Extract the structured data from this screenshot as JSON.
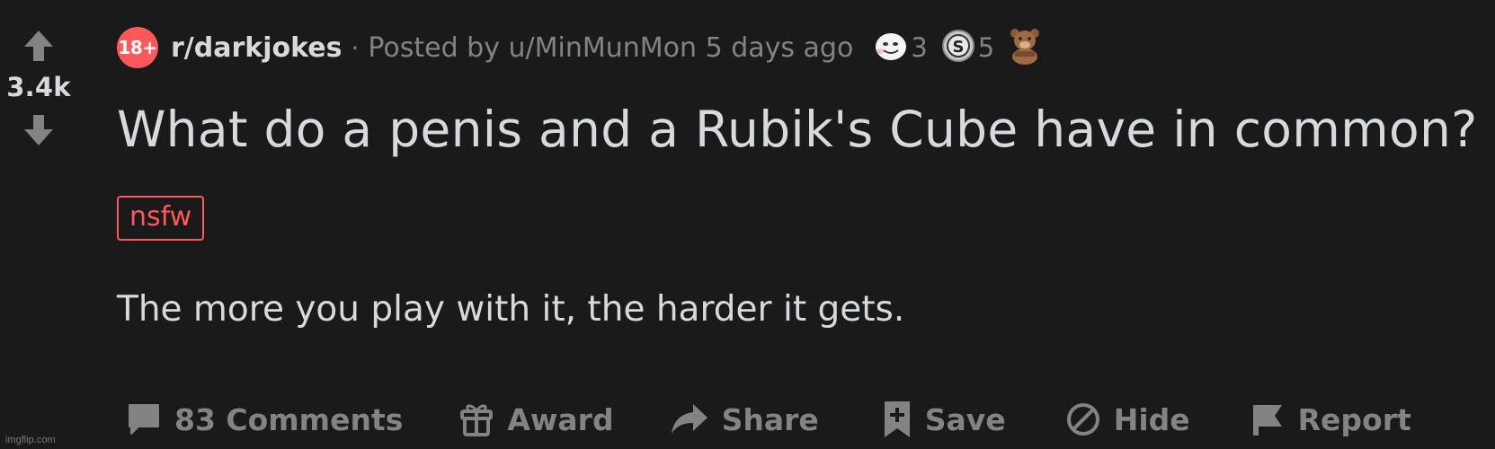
{
  "post": {
    "score": "3.4k",
    "subreddit_icon_label": "18+",
    "subreddit": "r/darkjokes",
    "separator": "·",
    "posted_by": "Posted by u/MinMunMon 5 days ago",
    "awards": [
      {
        "icon": "wholesome-award-icon",
        "count": "3"
      },
      {
        "icon": "silver-award-icon",
        "count": "5"
      },
      {
        "icon": "bear-award-icon",
        "count": ""
      }
    ],
    "title": "What do a penis and a Rubik's Cube have in common?",
    "flair": "nsfw",
    "body": "The more you play with it, the harder it gets."
  },
  "actions": {
    "comments_label": "83 Comments",
    "award_label": "Award",
    "share_label": "Share",
    "save_label": "Save",
    "hide_label": "Hide",
    "report_label": "Report"
  },
  "watermark": "imgflip.com",
  "colors": {
    "background": "#1a1a1b",
    "text": "#d7dadc",
    "muted": "#818384",
    "nsfw": "#ff585b"
  }
}
